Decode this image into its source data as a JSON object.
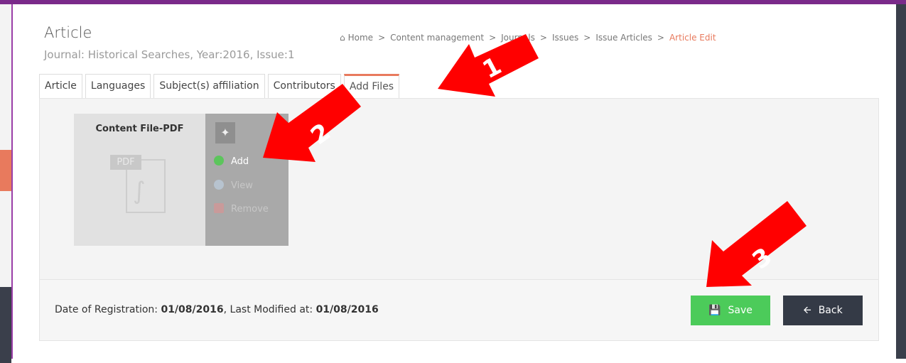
{
  "page": {
    "title": "Article",
    "subtitle": "Journal: Historical Searches, Year:2016, Issue:1"
  },
  "breadcrumb": {
    "items": [
      "Home",
      "Content management",
      "Journals",
      "Issues",
      "Issue Articles"
    ],
    "current": "Article Edit"
  },
  "tabs": [
    "Article",
    "Languages",
    "Subject(s) affiliation",
    "Contributors",
    "Add Files"
  ],
  "active_tab": "Add Files",
  "file_card": {
    "title": "Content File-PDF",
    "icon_label": "PDF",
    "actions": {
      "add": "Add",
      "view": "View",
      "remove": "Remove"
    }
  },
  "footer": {
    "registration_label": "Date of Registration:",
    "registration_date": "01/08/2016",
    "modified_label": "Last Modified at:",
    "modified_date": "01/08/2016"
  },
  "buttons": {
    "save": "Save",
    "back": "Back"
  },
  "annotations": [
    "1",
    "2",
    "3"
  ],
  "colors": {
    "accent": "#e87a5d",
    "save": "#4ccb5a",
    "back": "#343a46",
    "arrow": "#ff0000"
  }
}
